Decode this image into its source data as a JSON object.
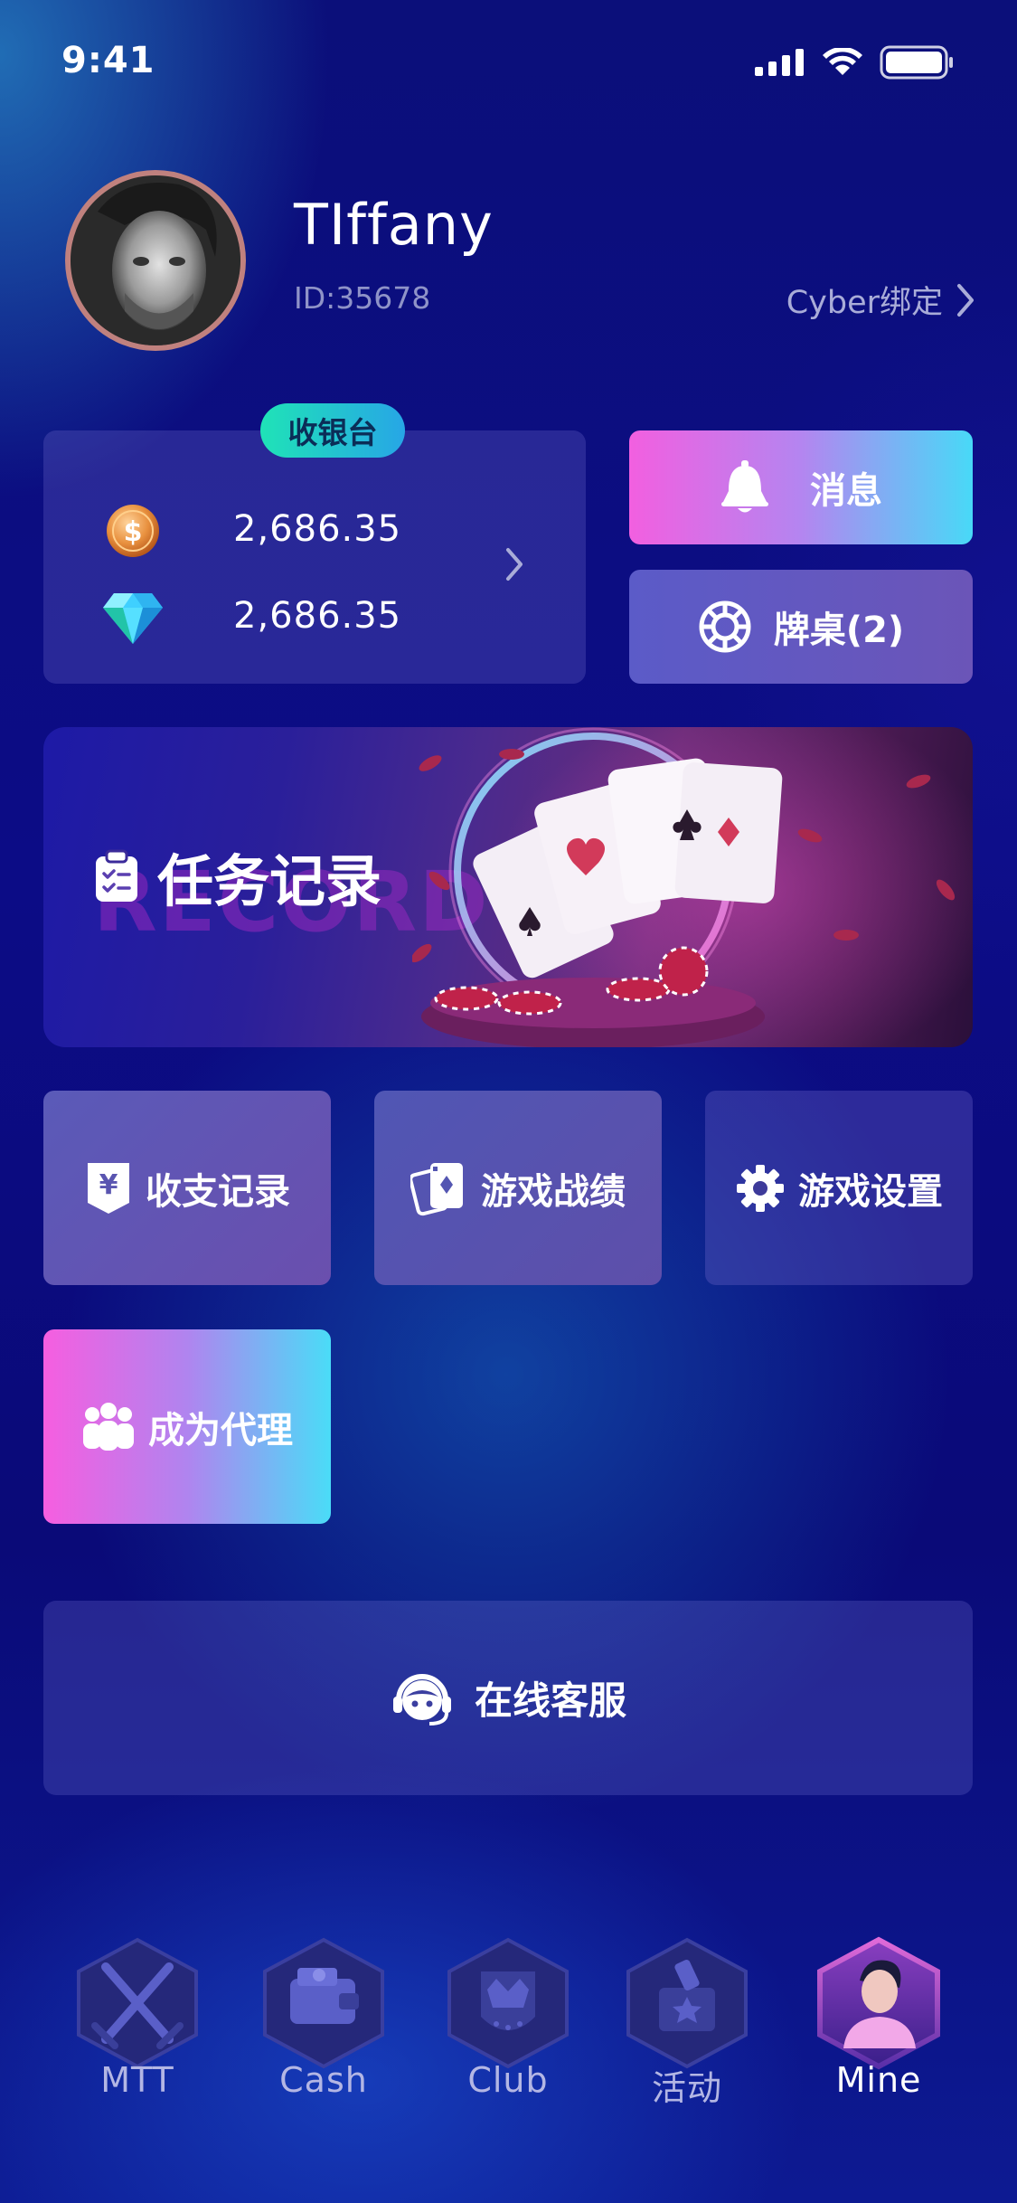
{
  "status_bar": {
    "time": "9:41"
  },
  "profile": {
    "username": "TIffany",
    "id_text": "ID:35678",
    "bind_label": "Cyber绑定"
  },
  "cashier": {
    "badge_label": "收银台",
    "coin_balance": "2,686.35",
    "diamond_balance": "2,686.35"
  },
  "actions": {
    "messages_label": "消息",
    "table_label": "牌桌(2)"
  },
  "banner": {
    "title": "任务记录",
    "bg_text": "RECORD"
  },
  "tiles": {
    "income_label": "收支记录",
    "game_record_label": "游戏战绩",
    "game_settings_label": "游戏设置",
    "agent_label": "成为代理"
  },
  "support": {
    "label": "在线客服"
  },
  "tabbar": {
    "items": [
      {
        "label": "MTT",
        "icon": "crossed-swords-icon"
      },
      {
        "label": "Cash",
        "icon": "wallet-icon"
      },
      {
        "label": "Club",
        "icon": "crown-shield-icon"
      },
      {
        "label": "活动",
        "icon": "gift-box-icon"
      },
      {
        "label": "Mine",
        "icon": "user-avatar-icon"
      }
    ],
    "active": "Mine"
  },
  "colors": {
    "accent_gradient_start": "#f25fe0",
    "accent_gradient_end": "#48d9f7",
    "badge_gradient_start": "#1fe3b7",
    "badge_gradient_end": "#27a6e6",
    "background": "#0c0c86"
  }
}
